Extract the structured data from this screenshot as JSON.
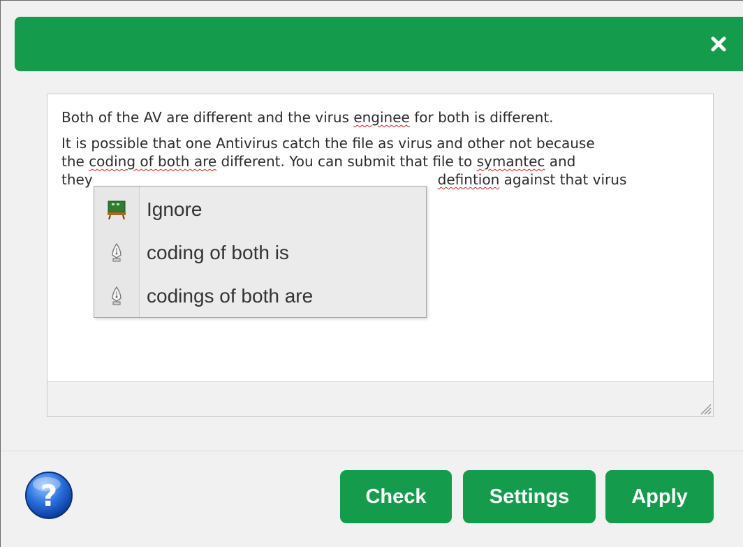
{
  "dialog": {
    "accent_color": "#149c4c",
    "close_icon": "close-icon"
  },
  "editor": {
    "paragraph1": {
      "before": "Both of the AV are different and the virus ",
      "misspelled": "enginee",
      "after": " for both is different."
    },
    "paragraph2": {
      "line1": "It is possible that one Antivirus catch the file as virus and other not because",
      "line2_before": "the ",
      "line2_flag": "coding of both are",
      "line2_middle": " different. You can submit that file to ",
      "line2_misspelled": "symantec",
      "line2_after": " and",
      "line3_start": "they",
      "line3_misspelled": "defintion",
      "line3_after": " against that virus"
    }
  },
  "context_menu": {
    "items": [
      {
        "label": "Ignore",
        "icon": "ignore-icon"
      },
      {
        "label": "coding of both is",
        "icon": "pen-nib-icon"
      },
      {
        "label": "codings of both are",
        "icon": "pen-nib-icon"
      }
    ]
  },
  "footer": {
    "help_icon": "help-icon",
    "check_label": "Check",
    "settings_label": "Settings",
    "apply_label": "Apply"
  }
}
